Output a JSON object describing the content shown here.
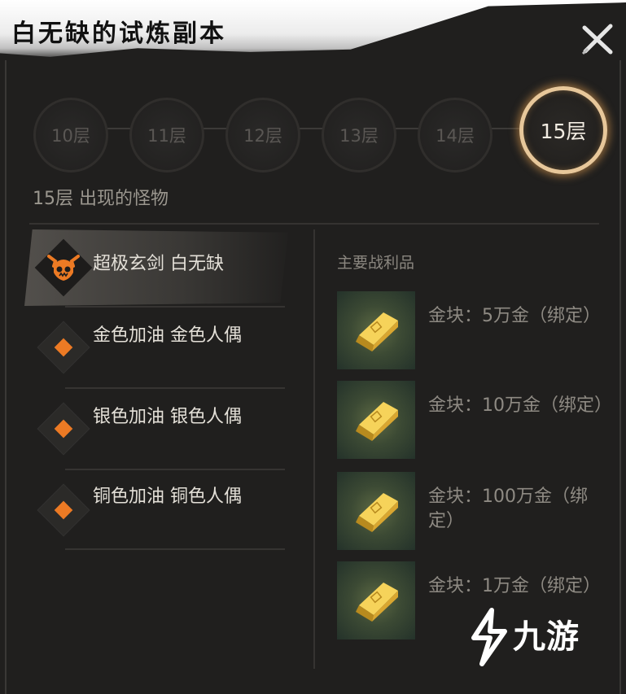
{
  "window": {
    "title": "白无缺的试炼副本",
    "close_icon": "close-icon"
  },
  "floors": {
    "items": [
      {
        "label": "10层",
        "active": false
      },
      {
        "label": "11层",
        "active": false
      },
      {
        "label": "12层",
        "active": false
      },
      {
        "label": "13层",
        "active": false
      },
      {
        "label": "14层",
        "active": false
      },
      {
        "label": "15层",
        "active": true
      }
    ]
  },
  "monsters": {
    "section_title": "15层 出现的怪物",
    "items": [
      {
        "name": "超极玄剑 白无缺",
        "icon": "boss-skull-icon",
        "selected": true
      },
      {
        "name": "金色加油 金色人偶",
        "icon": "diamond-marker-icon",
        "selected": false
      },
      {
        "name": "银色加油 银色人偶",
        "icon": "diamond-marker-icon",
        "selected": false
      },
      {
        "name": "铜色加油 铜色人偶",
        "icon": "diamond-marker-icon",
        "selected": false
      }
    ]
  },
  "loot": {
    "title": "主要战利品",
    "items": [
      {
        "text": "金块：5万金（绑定）",
        "icon": "gold-bar-icon"
      },
      {
        "text": "金块：10万金（绑定）",
        "icon": "gold-bar-icon"
      },
      {
        "text": "金块：100万金（绑定）",
        "icon": "gold-bar-icon"
      },
      {
        "text": "金块：1万金（绑定）",
        "icon": "gold-bar-icon"
      }
    ]
  },
  "watermark": {
    "text": "九游",
    "icon": "jiuyou-logo-icon"
  },
  "colors": {
    "accent_orange": "#ec7a24",
    "ring_gold": "#e7c79a",
    "background": "#201f1e"
  }
}
